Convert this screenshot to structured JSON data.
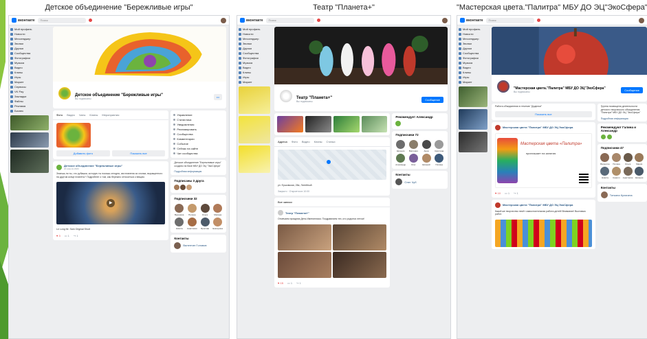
{
  "slide_decor": {
    "accent": "#6bb33e"
  },
  "panels": [
    {
      "title": "Детское объединение \"Бережливые игры\"",
      "group_name": "Детское объединение \"Бережливые игры\"",
      "group_sub": "Вы подписаны",
      "tabs": [
        "Фото",
        "Видео",
        "Чаты",
        "Клипы",
        "Мероприятия"
      ],
      "right_menu": [
        "Управление",
        "Статистика",
        "Уведомления",
        "Рекламировать",
        "Сообщества",
        "Комментарии",
        "Событие",
        "Сейчас на сайте",
        "Чат сообщества"
      ],
      "info_text": "Детское объединение \"Бережливые игры\" создано на базе МБУ ДО ЭЦ \"ЭкоСфера\"",
      "info_link": "Подробная информация",
      "friends_title": "Подписаны 3 друга",
      "subs_title": "Подписчики 32",
      "subs": [
        "Вероника",
        "Полина",
        "Ольга",
        "Милана",
        "Никита",
        "Анастасия",
        "Ярослав",
        "Екатерина"
      ],
      "contacts_title": "Контакты",
      "contact": "Валентин Головов",
      "post_author": "Детское объединение \"Бережливые игры\"",
      "post_date": "20 апреля 2024",
      "post_text": "Знаешь ли ты, что рубашка, которую ты носишь сегодня, изготовлена из хлопка, выращенного на другом конце планеты? Подробнее о том, как бережно относиться к вещам.",
      "video_caption": "Le Long Mr. Sam Original Short",
      "likes": "3",
      "comments": "1",
      "reposts": "1",
      "add_btn": "Добавить фото",
      "show_btn": "Показать все",
      "sidebar": [
        "Мой профиль",
        "Новости",
        "Мессенджер",
        "Звонки",
        "Друзья",
        "Сообщества",
        "Фотографии",
        "Музыка",
        "Видео",
        "Клипы",
        "Игры",
        "Маркет",
        "Сервисы",
        "VK Pay",
        "Закладки",
        "Файлы",
        "Реклама",
        "Бизнес"
      ]
    },
    {
      "title": "Театр \"Планета+\"",
      "group_name": "Театр \"Планета+\"",
      "group_sub": "Вы подписаны",
      "join_btn": "Сообщение",
      "tabs": [
        "Адреса",
        "Фото",
        "Видео",
        "Клипы",
        "Статьи"
      ],
      "address": "ул. Ершовская, 28а, Литейный",
      "address_sub": "Закрыто · Откроется в 10:00",
      "rec_title": "Рекомендует Александр",
      "subs_title": "Подписчики 72",
      "subs": [
        "Евгения",
        "Виктория",
        "Анна",
        "Кристина",
        "Александр",
        "Олег",
        "Евгений",
        "Полина"
      ],
      "contacts_title": "Контакты",
      "contact": "Олег Чуб",
      "post_author": "Театр \"Планета+\"",
      "post_text": "Отмечаем праздник День Именинника. Поздравляем тех, кто родился летом!",
      "likes": "15",
      "comments": "1",
      "reposts": "1",
      "all_posts": "Все записи",
      "cover_caption": "Театральное объединение"
    },
    {
      "title": "\"Мастерская цвета.\"Палитра\" МБУ ДО ЭЦ\"ЭкоСфера\"",
      "group_name": "\"Мастерская цвета.\"Палитра\" МБУ ДО ЭЦ\"ЭкоСфера\"",
      "group_sub": "Вы подписаны",
      "join_btn": "Сообщение",
      "notice": "Работа объединения в течение \"Доделки\"",
      "show_all": "Показать все",
      "info_text": "Группа посвящена деятельности детского творческого объединения \"Палитра\" МБУ ДО ЭЦ \"ЭкоСфера\"",
      "info_link": "Подробная информация",
      "rec_title": "Рекомендуют Галина и Александр",
      "subs_title": "Подписчики 47",
      "subs": [
        "Валентин",
        "Полина",
        "Ольга",
        "Мария",
        "Никита",
        "Кирилл",
        "Анастасия",
        "Евгения"
      ],
      "contacts_title": "Контакты",
      "contact": "Татьяна Кулагина",
      "post_author": "Мастерская цвета \"Палитра\" МБУ ДО ЭЦ ЭкоСфера",
      "post_title": "Мастерская цвета «Палитра»",
      "post_sub": "приглашает на занятия",
      "post2_text": "Какой же творчество несёт самостоятельная работа детей! Внимание! Выставка работ.",
      "likes": "10",
      "comments": "1",
      "reposts": "1"
    }
  ]
}
